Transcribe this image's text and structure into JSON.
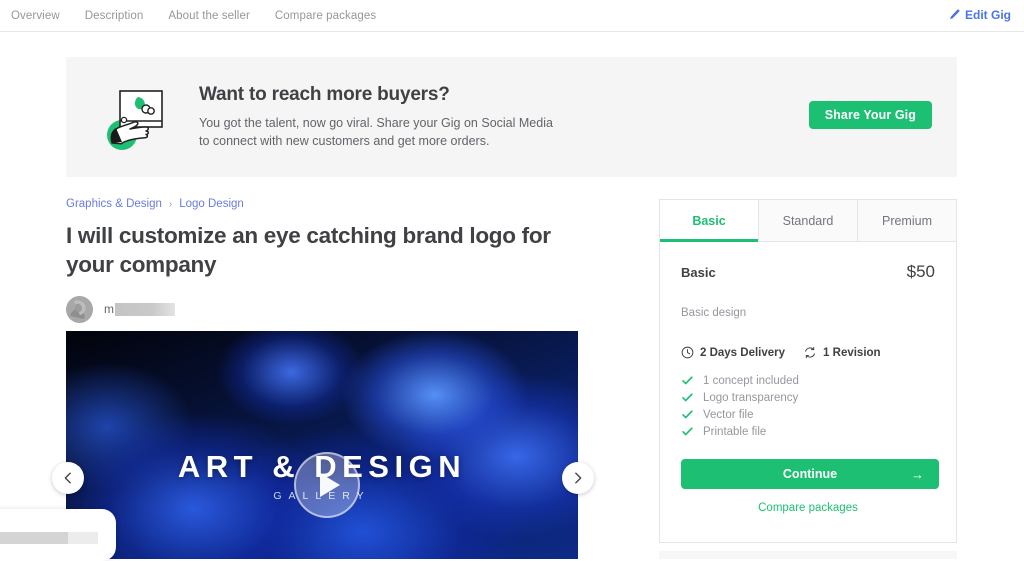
{
  "topnav": {
    "links": [
      {
        "label": "Overview"
      },
      {
        "label": "Description"
      },
      {
        "label": "About the seller"
      },
      {
        "label": "Compare packages"
      }
    ],
    "edit_gig_label": "Edit Gig",
    "edit_gig_icon": "pencil-icon",
    "edit_gig_color": "#4a73e8"
  },
  "banner": {
    "illustration_icon": "hand-holding-picture-illustration",
    "title": "Want to reach more buyers?",
    "subtitle_line1": "You got the talent, now go viral. Share your Gig on Social Media",
    "subtitle_line2": "to connect with new customers and get more orders.",
    "button_label": "Share Your Gig",
    "button_color": "#1dbf73",
    "background_color": "#f5f5f5"
  },
  "gig": {
    "breadcrumb": {
      "category": "Graphics & Design",
      "separator": "›",
      "subcategory": "Logo Design"
    },
    "title": "I will customize an eye catching brand logo for your company",
    "seller": {
      "avatar_icon": "seller-avatar",
      "name_visible": "m",
      "name_redacted": true
    }
  },
  "carousel": {
    "slide_wordmark": "ART & DESIGN",
    "slide_subtext": "GALLERY",
    "play_icon": "play-icon",
    "prev_icon": "chevron-left-icon",
    "next_icon": "chevron-right-icon"
  },
  "package": {
    "tabs": [
      {
        "label": "Basic",
        "active": true
      },
      {
        "label": "Standard",
        "active": false
      },
      {
        "label": "Premium",
        "active": false
      }
    ],
    "active_tab_color": "#1dbf73",
    "name": "Basic",
    "price": "$50",
    "description": "Basic design",
    "delivery": {
      "icon": "clock-icon",
      "label": "2 Days Delivery"
    },
    "revisions": {
      "icon": "revision-icon",
      "label": "1 Revision"
    },
    "features": [
      {
        "icon": "check-icon",
        "label": "1 concept included"
      },
      {
        "icon": "check-icon",
        "label": "Logo transparency"
      },
      {
        "icon": "check-icon",
        "label": "Vector file"
      },
      {
        "icon": "check-icon",
        "label": "Printable file"
      }
    ],
    "continue_label": "Continue",
    "continue_arrow": "→",
    "compare_label": "Compare packages"
  },
  "download_shelf": {
    "icon": "download-shelf"
  }
}
